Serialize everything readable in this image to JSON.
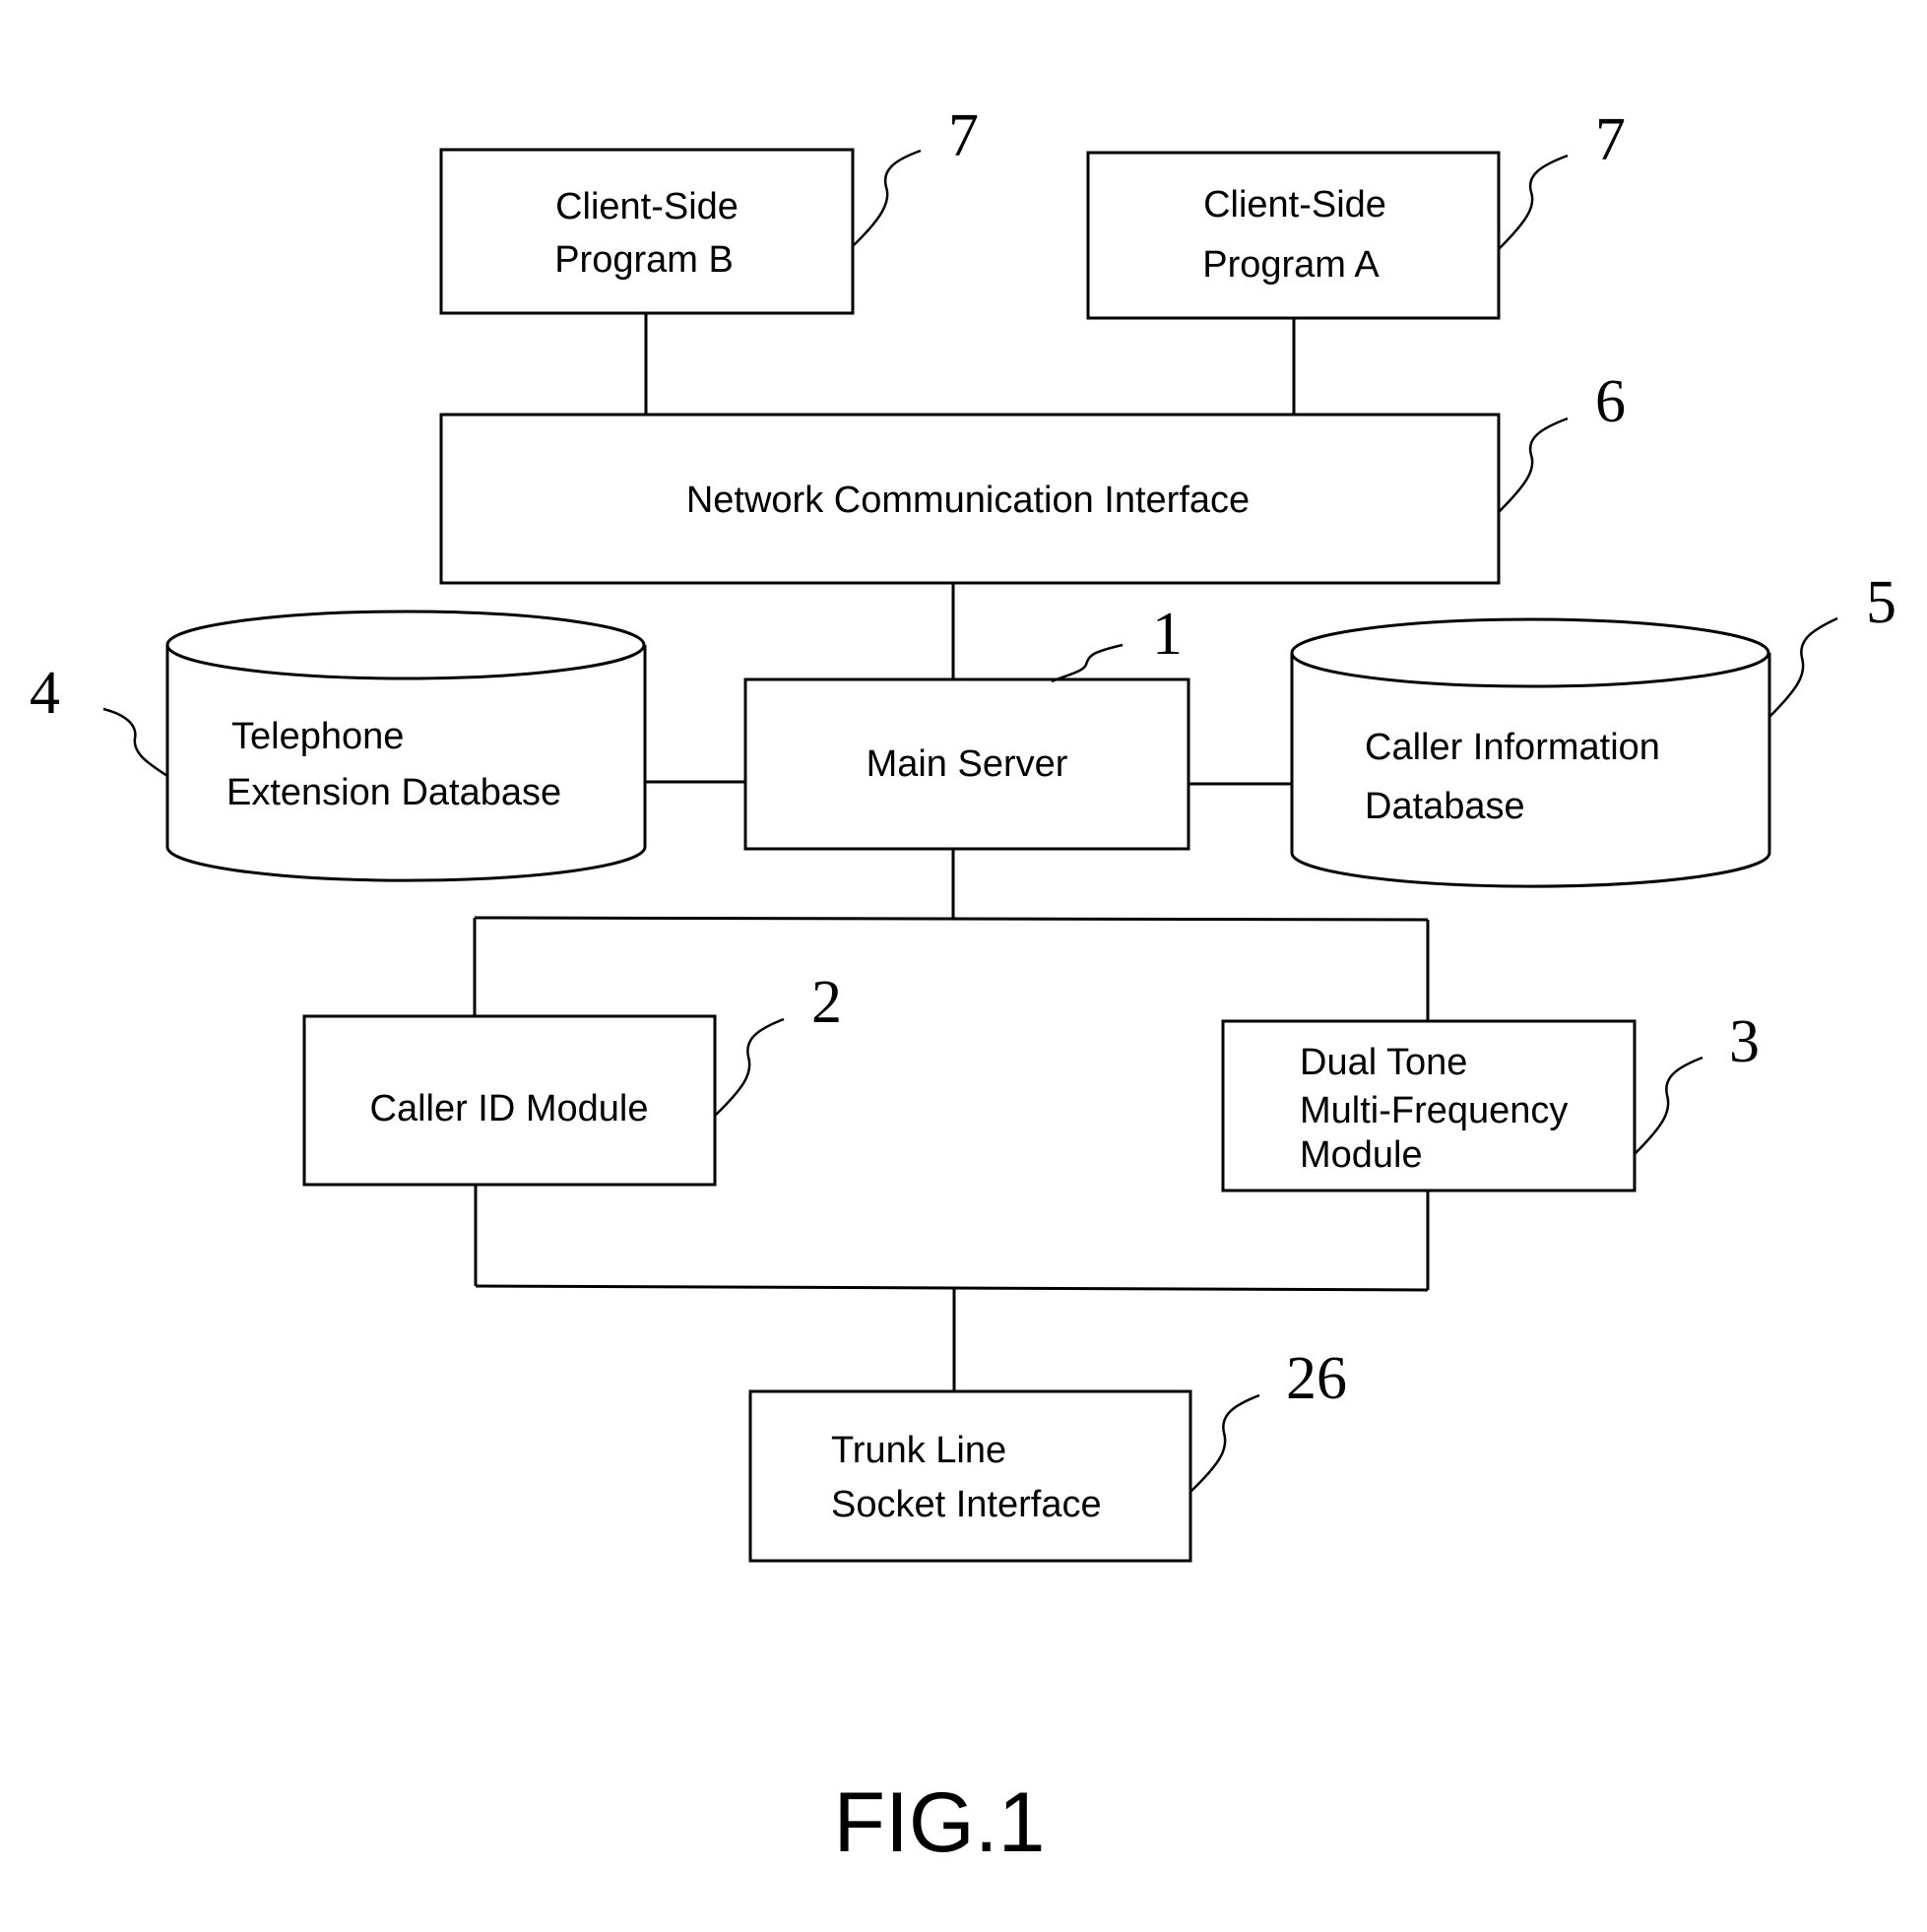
{
  "figure": {
    "caption": "FIG.1",
    "stroke_color": "#000000",
    "background_color": "#ffffff"
  },
  "components": {
    "client_b": {
      "lines": [
        "Client-Side",
        "Program B"
      ],
      "ref": "7"
    },
    "client_a": {
      "lines": [
        "Client-Side",
        "Program A"
      ],
      "ref": "7"
    },
    "network_interface": {
      "lines": [
        "Network Communication Interface"
      ],
      "ref": "6"
    },
    "main_server": {
      "lines": [
        "Main Server"
      ],
      "ref": "1"
    },
    "telephone_db": {
      "lines": [
        "Telephone",
        "Extension Database"
      ],
      "ref": "4"
    },
    "caller_info_db": {
      "lines": [
        "Caller Information",
        "Database"
      ],
      "ref": "5"
    },
    "caller_id_module": {
      "lines": [
        "Caller ID Module"
      ],
      "ref": "2"
    },
    "dtmf_module": {
      "lines": [
        "Dual Tone",
        "Multi-Frequency",
        "Module"
      ],
      "ref": "3"
    },
    "trunk_interface": {
      "lines": [
        "Trunk Line",
        "Socket Interface"
      ],
      "ref": "26"
    }
  },
  "connections": [
    [
      "client_b",
      "network_interface"
    ],
    [
      "client_a",
      "network_interface"
    ],
    [
      "network_interface",
      "main_server"
    ],
    [
      "telephone_db",
      "main_server"
    ],
    [
      "main_server",
      "caller_info_db"
    ],
    [
      "main_server",
      "caller_id_module"
    ],
    [
      "main_server",
      "dtmf_module"
    ],
    [
      "caller_id_module",
      "trunk_interface"
    ],
    [
      "dtmf_module",
      "trunk_interface"
    ]
  ]
}
